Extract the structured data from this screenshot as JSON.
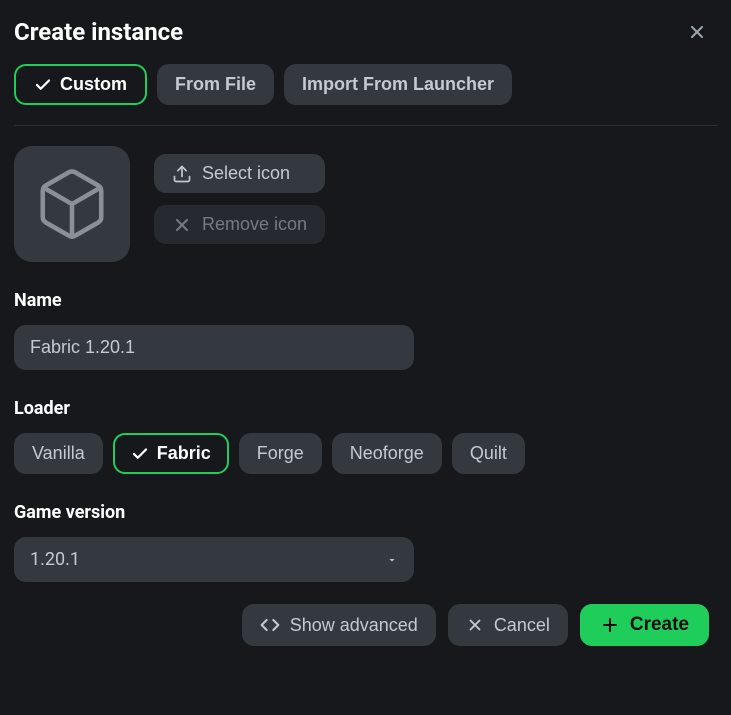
{
  "header": {
    "title": "Create instance"
  },
  "tabs": {
    "custom": "Custom",
    "from_file": "From File",
    "import": "Import From Launcher"
  },
  "icon_actions": {
    "select": "Select icon",
    "remove": "Remove icon"
  },
  "name_section": {
    "label": "Name",
    "value": "Fabric 1.20.1"
  },
  "loader_section": {
    "label": "Loader",
    "options": {
      "vanilla": "Vanilla",
      "fabric": "Fabric",
      "forge": "Forge",
      "neoforge": "Neoforge",
      "quilt": "Quilt"
    }
  },
  "version_section": {
    "label": "Game version",
    "selected": "1.20.1"
  },
  "footer": {
    "show_advanced": "Show advanced",
    "cancel": "Cancel",
    "create": "Create"
  }
}
